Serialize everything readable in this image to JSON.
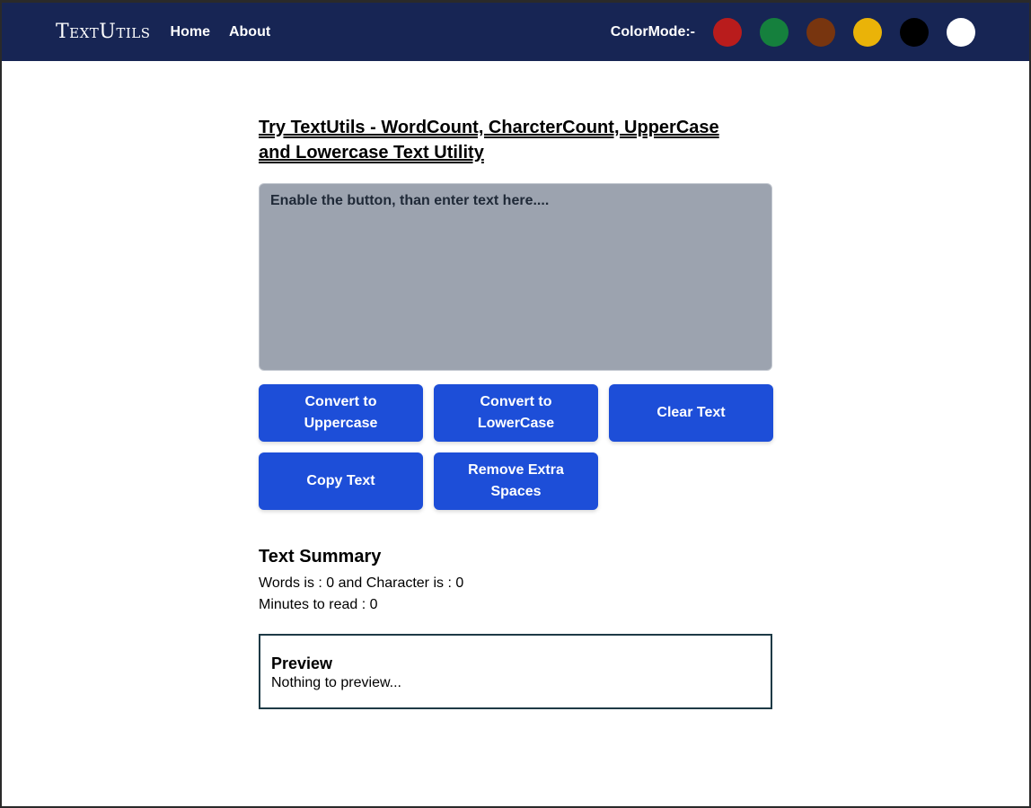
{
  "navbar": {
    "brand": "TextUtils",
    "links": {
      "home": "Home",
      "about": "About"
    },
    "color_mode_label": "ColorMode:-",
    "swatches": {
      "red": "#b91c1c",
      "green": "#15803d",
      "brown": "#78350f",
      "yellow": "#eab308",
      "black": "#000000",
      "white": "#ffffff"
    },
    "background": "#172554"
  },
  "main": {
    "heading": "Try TextUtils - WordCount, CharcterCount, UpperCase and Lowercase Text Utility",
    "textarea": {
      "value": "",
      "placeholder": "Enable the button, than enter text here...."
    },
    "buttons": {
      "uppercase": "Convert to Uppercase",
      "lowercase": "Convert to LowerCase",
      "clear": "Clear Text",
      "copy": "Copy Text",
      "remove_spaces": "Remove Extra Spaces"
    },
    "button_color": "#1d4ed8"
  },
  "summary": {
    "title": "Text Summary",
    "counts": "Words is : 0 and Character is : 0",
    "minutes": "Minutes to read : 0"
  },
  "preview": {
    "title": "Preview",
    "text": "Nothing to preview..."
  }
}
